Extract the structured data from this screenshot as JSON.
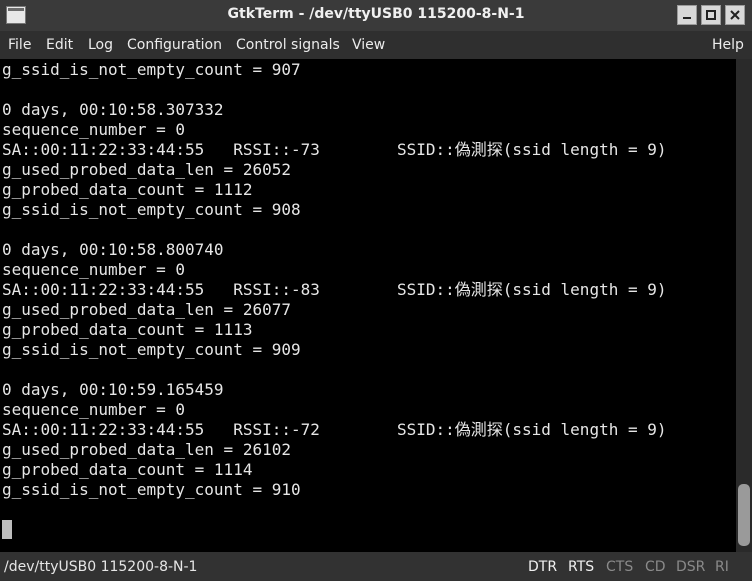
{
  "window": {
    "title": "GtkTerm - /dev/ttyUSB0  115200-8-N-1"
  },
  "menu": {
    "items": [
      "File",
      "Edit",
      "Log",
      "Configuration",
      "Control signals",
      "View",
      "Help"
    ]
  },
  "terminal": {
    "lines": [
      "g_ssid_is_not_empty_count = 907",
      "",
      "0 days, 00:10:58.307332",
      "sequence_number = 0",
      "SA::00:11:22:33:44:55   RSSI::-73        SSID::偽測探(ssid length = 9)",
      "g_used_probed_data_len = 26052",
      "g_probed_data_count = 1112",
      "g_ssid_is_not_empty_count = 908",
      "",
      "0 days, 00:10:58.800740",
      "sequence_number = 0",
      "SA::00:11:22:33:44:55   RSSI::-83        SSID::偽測探(ssid length = 9)",
      "g_used_probed_data_len = 26077",
      "g_probed_data_count = 1113",
      "g_ssid_is_not_empty_count = 909",
      "",
      "0 days, 00:10:59.165459",
      "sequence_number = 0",
      "SA::00:11:22:33:44:55   RSSI::-72        SSID::偽測探(ssid length = 9)",
      "g_used_probed_data_len = 26102",
      "g_probed_data_count = 1114",
      "g_ssid_is_not_empty_count = 910"
    ]
  },
  "statusbar": {
    "port": "/dev/ttyUSB0  115200-8-N-1",
    "signals": [
      {
        "label": "DTR",
        "active": true
      },
      {
        "label": "RTS",
        "active": true
      },
      {
        "label": "CTS",
        "active": false
      },
      {
        "label": "CD",
        "active": false
      },
      {
        "label": "DSR",
        "active": false
      },
      {
        "label": "RI",
        "active": false
      }
    ]
  },
  "icons": {
    "app": "terminal-icon",
    "minimize": "minimize-icon",
    "maximize": "maximize-icon",
    "close": "close-icon"
  }
}
